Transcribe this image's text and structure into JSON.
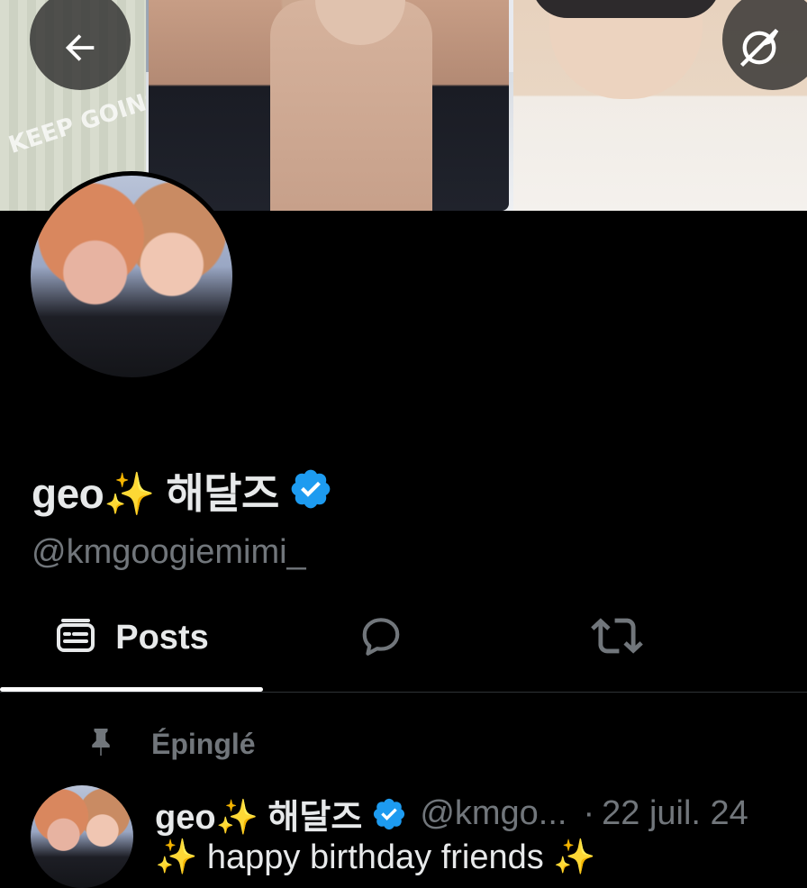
{
  "header": {
    "back_icon": "arrow-left-icon",
    "explore_icon": "explore-icon",
    "banner_text": "KEEP GOING!"
  },
  "profile": {
    "display_name": "geo✨ 해달즈",
    "verified": true,
    "handle": "@kmgoogiemimi_"
  },
  "tabs": [
    {
      "label": "Posts",
      "icon": "posts-icon",
      "selected": true
    },
    {
      "label": "",
      "icon": "reply-icon",
      "selected": false
    },
    {
      "label": "",
      "icon": "repost-icon",
      "selected": false
    }
  ],
  "pinned": {
    "icon": "pin-icon",
    "label": "Épinglé"
  },
  "tweet": {
    "display_name": "geo✨ 해달즈",
    "handle": "@kmgo...",
    "separator": "·",
    "date": "22 juil. 24",
    "text": "✨ happy birthday friends ✨"
  },
  "colors": {
    "background": "#000000",
    "text": "#e7e9ea",
    "muted": "#71767b",
    "verified": "#1d9bf0",
    "border": "#2f3336"
  }
}
